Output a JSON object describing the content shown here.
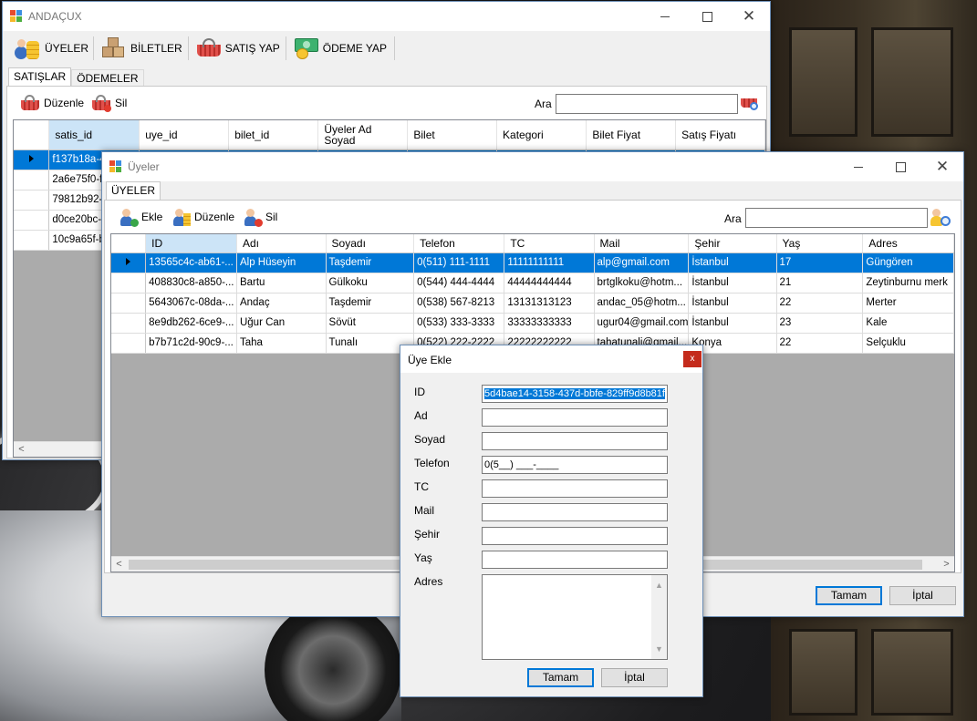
{
  "main_window": {
    "title": "ANDAÇUX",
    "menu": [
      {
        "label": "ÜYELER",
        "icon": "users-coins-icon"
      },
      {
        "label": "BİLETLER",
        "icon": "boxes-icon"
      },
      {
        "label": "SATIŞ YAP",
        "icon": "basket-icon"
      },
      {
        "label": "ÖDEME YAP",
        "icon": "money-icon"
      }
    ],
    "tabs": [
      {
        "label": "SATIŞLAR"
      },
      {
        "label": "ÖDEMELER"
      }
    ],
    "toolbar": {
      "edit_label": "Düzenle",
      "delete_label": "Sil",
      "search_label": "Ara",
      "search_value": ""
    },
    "columns": [
      "satis_id",
      "uye_id",
      "bilet_id",
      "Üyeler Ad\nSoyad",
      "Bilet",
      "Kategori",
      "Bilet Fiyat",
      "Satış Fiyatı"
    ],
    "rows": [
      "f137b18a-4",
      "2a6e75f0-f8",
      "79812b92-f",
      "d0ce20bc-9",
      "10c9a65f-b"
    ]
  },
  "members_window": {
    "title": "Üyeler",
    "tab": "ÜYELER",
    "toolbar": {
      "add_label": "Ekle",
      "edit_label": "Düzenle",
      "delete_label": "Sil",
      "search_label": "Ara",
      "search_value": ""
    },
    "columns": [
      "ID",
      "Adı",
      "Soyadı",
      "Telefon",
      "TC",
      "Mail",
      "Şehir",
      "Yaş",
      "Adres"
    ],
    "rows": [
      [
        "13565c4c-ab61-...",
        "Alp Hüseyin",
        "Taşdemir",
        "0(511) 111-1111",
        "11111111111",
        "alp@gmail.com",
        "İstanbul",
        "17",
        "Güngören"
      ],
      [
        "408830c8-a850-...",
        "Bartu",
        "Gülkoku",
        "0(544) 444-4444",
        "44444444444",
        "brtglkoku@hotm...",
        "İstanbul",
        "21",
        "Zeytinburnu merk"
      ],
      [
        "5643067c-08da-...",
        "Andaç",
        "Taşdemir",
        "0(538) 567-8213",
        "13131313123",
        "andac_05@hotm...",
        "İstanbul",
        "22",
        "Merter"
      ],
      [
        "8e9db262-6ce9-...",
        "Uğur Can",
        "Sövüt",
        "0(533) 333-3333",
        "33333333333",
        "ugur04@gmail.com",
        "İstanbul",
        "23",
        "Kale"
      ],
      [
        "b7b71c2d-90c9-...",
        "Taha",
        "Tunalı",
        "0(522) 222-2222",
        "22222222222",
        "tahatunali@gmail...",
        "Konya",
        "22",
        "Selçuklu"
      ]
    ],
    "ok_label": "Tamam",
    "cancel_label": "İptal"
  },
  "dialog": {
    "title": "Üye Ekle",
    "close_glyph": "x",
    "labels": {
      "id": "ID",
      "ad": "Ad",
      "soyad": "Soyad",
      "telefon": "Telefon",
      "tc": "TC",
      "mail": "Mail",
      "sehir": "Şehir",
      "yas": "Yaş",
      "adres": "Adres"
    },
    "values": {
      "id": "5d4bae14-3158-437d-bbfe-829ff9d8b81f",
      "ad": "",
      "soyad": "",
      "telefon": "0(5__) ___-____",
      "tc": "",
      "mail": "",
      "sehir": "",
      "yas": "",
      "adres": ""
    },
    "ok_label": "Tamam",
    "cancel_label": "İptal"
  },
  "colors": {
    "selection": "#0078d7",
    "dialog_close": "#c42b1c",
    "default_button_border": "#0078d7"
  }
}
